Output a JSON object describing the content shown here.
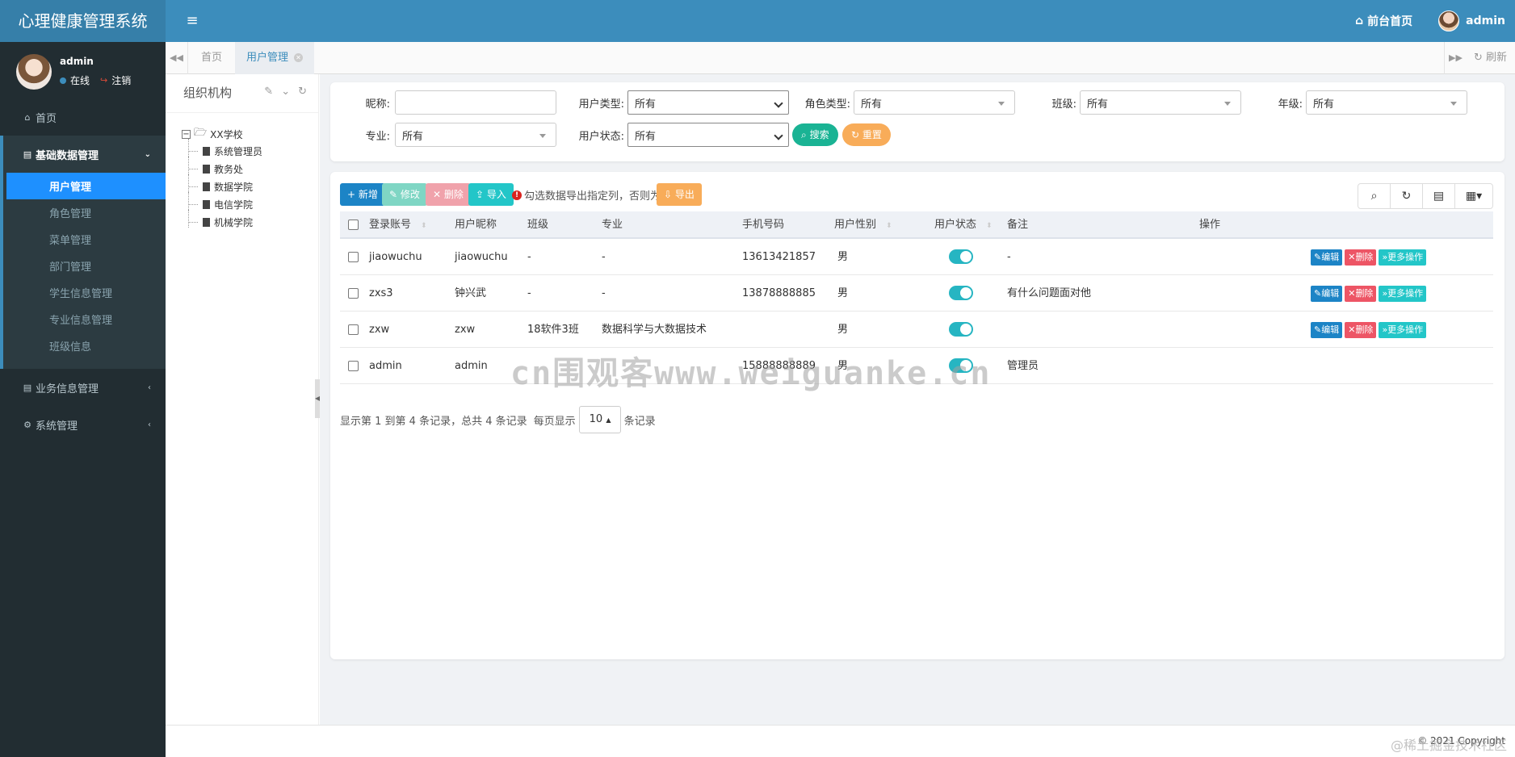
{
  "header": {
    "brand": "心理健康管理系统",
    "front_home": "前台首页",
    "user": "admin",
    "colors": {
      "primary": "#3c8dbc",
      "brand_bg": "#367fa9"
    }
  },
  "sidebar": {
    "user_name": "admin",
    "online": "在线",
    "logout": "注销",
    "home": "首页",
    "groups": [
      {
        "label": "基础数据管理",
        "open": true
      },
      {
        "label": "业务信息管理",
        "open": false
      },
      {
        "label": "系统管理",
        "open": false
      }
    ],
    "sub_items": [
      "用户管理",
      "角色管理",
      "菜单管理",
      "部门管理",
      "学生信息管理",
      "专业信息管理",
      "班级信息"
    ],
    "active": "用户管理"
  },
  "tabs": {
    "items": [
      "首页",
      "用户管理"
    ],
    "active": "用户管理",
    "refresh": "刷新"
  },
  "org": {
    "title": "组织机构",
    "root": "XX学校",
    "children": [
      "系统管理员",
      "教务处",
      "数据学院",
      "电信学院",
      "机械学院"
    ]
  },
  "search": {
    "labels": {
      "nickname": "昵称:",
      "user_type": "用户类型:",
      "role_type": "角色类型:",
      "class": "班级:",
      "grade": "年级:",
      "major": "专业:",
      "user_status": "用户状态:"
    },
    "values": {
      "nickname": "",
      "user_type": "所有",
      "role_type": "所有",
      "class": "所有",
      "grade": "所有",
      "major": "所有",
      "user_status": "所有"
    },
    "search_btn": "搜索",
    "reset_btn": "重置"
  },
  "toolbar": {
    "add": "新增",
    "edit": "修改",
    "delete": "删除",
    "import": "导入",
    "hint": "勾选数据导出指定列，否则为全部",
    "export": "导出"
  },
  "table": {
    "columns": [
      "登录账号",
      "用户昵称",
      "班级",
      "专业",
      "手机号码",
      "用户性别",
      "用户状态",
      "备注",
      "操作"
    ],
    "rows": [
      {
        "account": "jiaowuchu",
        "nickname": "jiaowuchu",
        "class": "-",
        "major": "-",
        "phone": "13613421857",
        "gender": "男",
        "status_on": true,
        "remark": "-",
        "has_ops": true
      },
      {
        "account": "zxs3",
        "nickname": "钟兴武",
        "class": "-",
        "major": "-",
        "phone": "13878888885",
        "gender": "男",
        "status_on": true,
        "remark": "有什么问题面对他",
        "has_ops": true
      },
      {
        "account": "zxw",
        "nickname": "zxw",
        "class": "18软件3班",
        "major": "数据科学与大数据技术",
        "phone": "",
        "gender": "男",
        "status_on": true,
        "remark": "",
        "has_ops": true
      },
      {
        "account": "admin",
        "nickname": "admin",
        "class": "",
        "major": "",
        "phone": "15888888889",
        "gender": "男",
        "status_on": true,
        "remark": "管理员",
        "has_ops": false
      }
    ],
    "op_labels": {
      "edit": "编辑",
      "delete": "删除",
      "more": "更多操作"
    }
  },
  "pagination": {
    "summary": "显示第 1 到第 4 条记录，总共 4 条记录",
    "per_page_label": "每页显示",
    "per_page": "10",
    "suffix": "条记录"
  },
  "footer": {
    "copyright": "© 2021 Copyright"
  },
  "watermarks": {
    "center": "cn围观客www.weiguanke.cn",
    "corner": "@稀土掘金技术社区"
  }
}
